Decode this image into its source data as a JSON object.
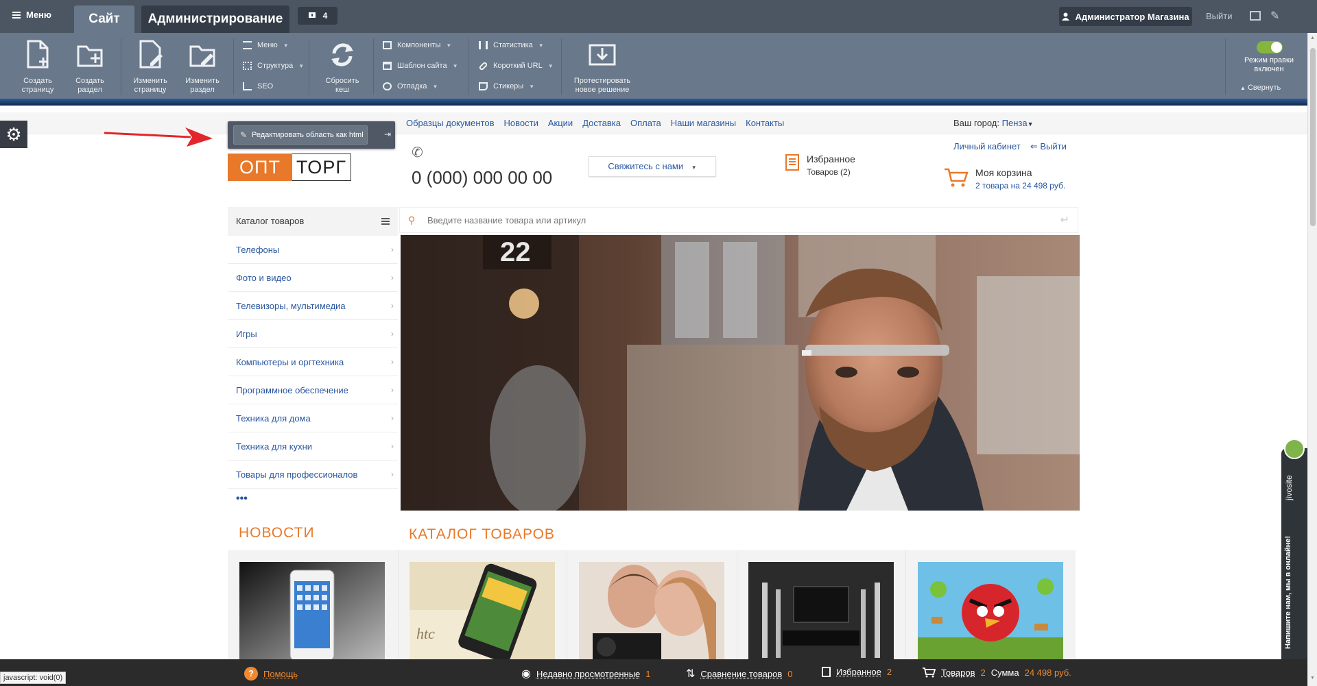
{
  "admin_top": {
    "menu_label": "Меню",
    "tab_site": "Сайт",
    "tab_admin": "Администрирование",
    "notifications_count": "4",
    "user_label": "Администратор Магазина",
    "logout_label": "Выйти"
  },
  "toolbar": {
    "create_page": [
      "Создать",
      "страницу"
    ],
    "create_section": [
      "Создать",
      "раздел"
    ],
    "edit_page": [
      "Изменить",
      "страницу"
    ],
    "edit_section": [
      "Изменить",
      "раздел"
    ],
    "menu": "Меню",
    "structure": "Структура",
    "seo": "SEO",
    "reset_cache": [
      "Сбросить",
      "кеш"
    ],
    "components": "Компоненты",
    "site_template": "Шаблон сайта",
    "debug": "Отладка",
    "statistics": "Статистика",
    "short_url": "Короткий URL",
    "stickers": "Стикеры",
    "test_solution": [
      "Протестировать",
      "новое решение"
    ],
    "edit_mode": [
      "Режим правки",
      "включен"
    ],
    "collapse": "Свернуть"
  },
  "edit_popup": {
    "button_label": "Редактировать область как html"
  },
  "top_nav": {
    "items": [
      "Образцы документов",
      "Новости",
      "Акции",
      "Доставка",
      "Оплата",
      "Наши магазины",
      "Контакты"
    ]
  },
  "city": {
    "label": "Ваш город:",
    "value": "Пенза"
  },
  "header": {
    "logo_part1": "ОПТ",
    "logo_part2": "ТОРГ",
    "phone": "0 (000) 000 00 00",
    "contact_button": "Свяжитесь с нами",
    "favorites_title": "Избранное",
    "favorites_count": "Товаров (2)",
    "personal_account": "Личный кабинет",
    "logout": "Выйти",
    "cart_title": "Моя корзина",
    "cart_summary": "2 товара на 24 498 руб."
  },
  "catalog": {
    "title": "Каталог товаров",
    "items": [
      "Телефоны",
      "Фото и видео",
      "Телевизоры, мультимедиа",
      "Игры",
      "Компьютеры и оргтехника",
      "Программное обеспечение",
      "Техника для дома",
      "Техника для кухни",
      "Товары для профессионалов"
    ],
    "more": "•••"
  },
  "search": {
    "placeholder": "Введите название товара или артикул"
  },
  "banner": {
    "building_number": "22"
  },
  "sections": {
    "news_title": "НОВОСТИ",
    "catalog_title": "КАТАЛОГ ТОВАРОВ"
  },
  "products": {
    "htc_text": "htc"
  },
  "bottom_bar": {
    "help": "Помощь",
    "recent_label": "Недавно просмотренные",
    "recent_count": "1",
    "compare_label": "Сравнение товаров",
    "compare_count": "0",
    "favorites_label": "Избранное",
    "favorites_count": "2",
    "goods_label": "Товаров",
    "goods_count": "2",
    "sum_label": "Сумма",
    "sum_value": "24 498 руб."
  },
  "status_tip": "javascript: void(0)",
  "jivo": {
    "brand": "jivosite",
    "message": "Напишите нам, мы в онлайне!"
  },
  "colors": {
    "accent": "#e8792a",
    "link": "#2a57a0",
    "admin_bar": "#4c5663",
    "toolbar": "#69788a"
  }
}
